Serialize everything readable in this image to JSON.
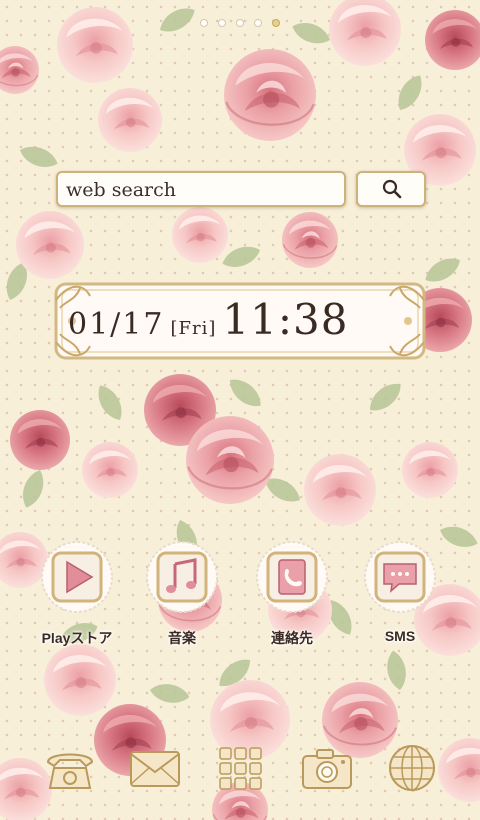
{
  "page_indicator": {
    "count": 5,
    "active_index": 4
  },
  "search": {
    "placeholder": "web search"
  },
  "clock": {
    "date": "01/17",
    "day": "[Fri]",
    "time": "11:38"
  },
  "apps": [
    {
      "label": "Playストア",
      "icon": "play-store-icon"
    },
    {
      "label": "音楽",
      "icon": "music-note-icon"
    },
    {
      "label": "連絡先",
      "icon": "contacts-icon"
    },
    {
      "label": "SMS",
      "icon": "sms-icon"
    }
  ],
  "dock": [
    {
      "icon": "phone-icon"
    },
    {
      "icon": "mail-icon"
    },
    {
      "icon": "app-drawer-icon"
    },
    {
      "icon": "camera-icon"
    },
    {
      "icon": "browser-globe-icon"
    }
  ],
  "colors": {
    "background": "#f8efd9",
    "rose": "#e79aa3",
    "gold": "#cdb27a",
    "text": "#3b2a24"
  }
}
